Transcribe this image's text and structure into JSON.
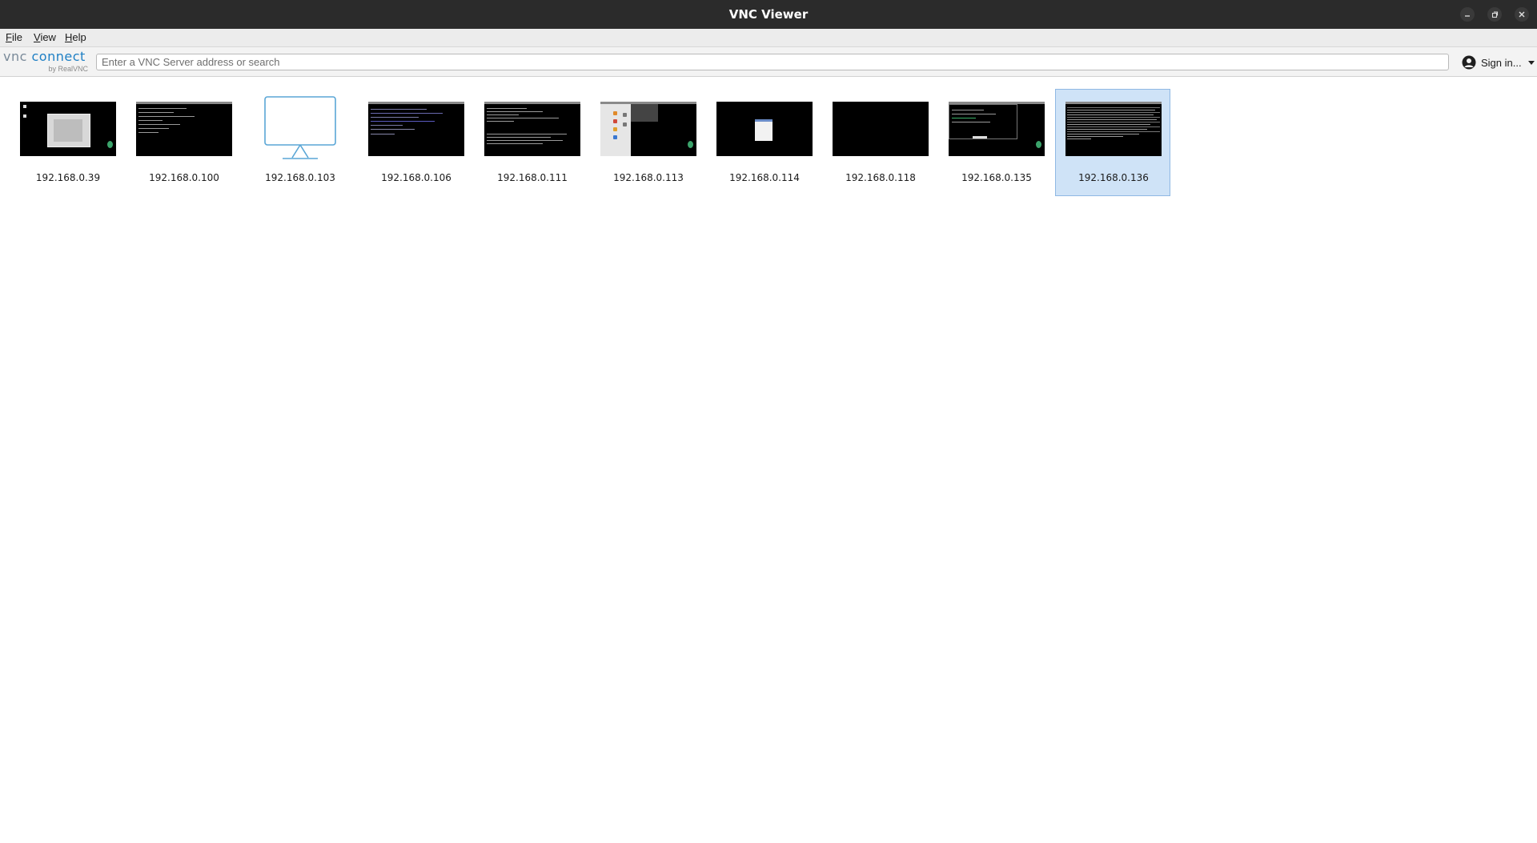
{
  "window": {
    "title": "VNC Viewer"
  },
  "menu": {
    "file": {
      "mnemonic": "F",
      "rest": "ile"
    },
    "view": {
      "mnemonic": "V",
      "rest": "iew"
    },
    "help": {
      "mnemonic": "H",
      "rest": "elp"
    }
  },
  "toolbar": {
    "logo_vnc": "vnc",
    "logo_connect": "connect",
    "logo_by": "by RealVNC",
    "search_placeholder": "Enter a VNC Server address or search",
    "signin_label": "Sign in..."
  },
  "connections": [
    {
      "label": "192.168.0.39",
      "preview": "desktop-dialog"
    },
    {
      "label": "192.168.0.100",
      "preview": "terminal"
    },
    {
      "label": "192.168.0.103",
      "preview": "monitor-icon"
    },
    {
      "label": "192.168.0.106",
      "preview": "terminal-blue"
    },
    {
      "label": "192.168.0.111",
      "preview": "terminal"
    },
    {
      "label": "192.168.0.113",
      "preview": "desktop-menu"
    },
    {
      "label": "192.168.0.114",
      "preview": "desktop-small-window"
    },
    {
      "label": "192.168.0.118",
      "preview": "blank"
    },
    {
      "label": "192.168.0.135",
      "preview": "terminal-green"
    },
    {
      "label": "192.168.0.136",
      "preview": "terminal-dense",
      "selected": true
    }
  ],
  "colors": {
    "titlebar": "#2b2b2b",
    "accent": "#1e7fc4",
    "selection": "#cfe3f7",
    "monitor_icon": "#5aa6d6"
  }
}
